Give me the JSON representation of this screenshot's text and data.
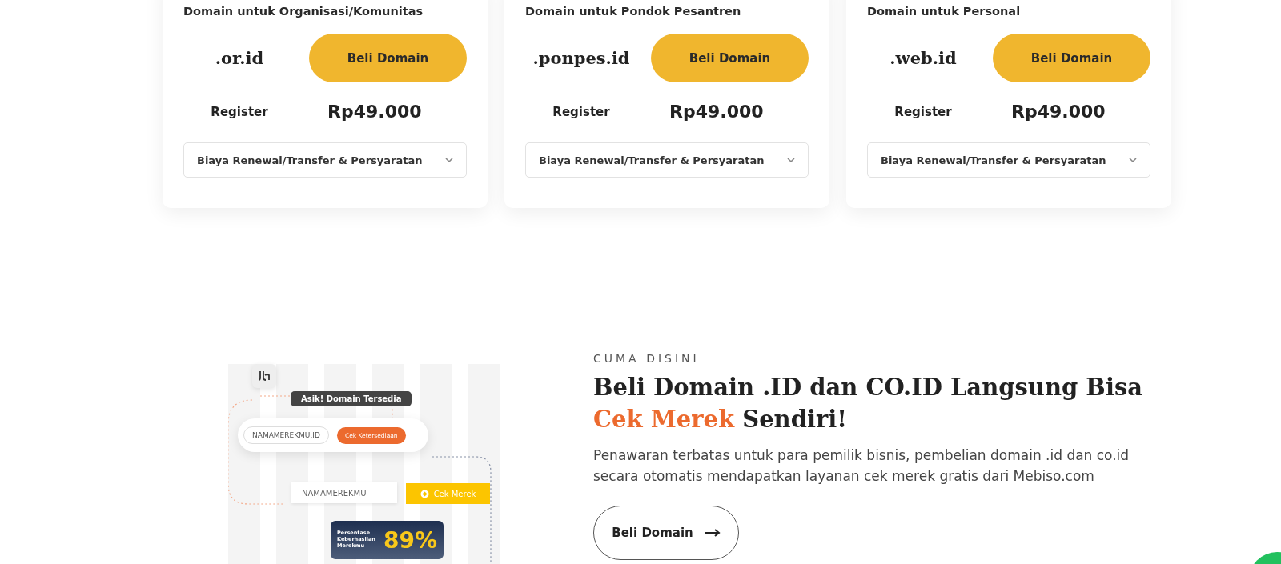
{
  "domain_cards": [
    {
      "subtitle": "Domain untuk Organisasi/Komunitas",
      "extension": ".or.id",
      "buy_button": "Beli Domain",
      "price_label": "Register",
      "price": "Rp49.000",
      "details_dropdown": {
        "label": "Biaya Renewal/Transfer & Persyaratan",
        "expanded": false
      }
    },
    {
      "subtitle": "Domain untuk Pondok Pesantren",
      "extension": ".ponpes.id",
      "buy_button": "Beli Domain",
      "price_label": "Register",
      "price": "Rp49.000",
      "details_dropdown": {
        "label": "Biaya Renewal/Transfer & Persyaratan",
        "expanded": false
      }
    },
    {
      "subtitle": "Domain untuk Personal",
      "extension": ".web.id",
      "buy_button": "Beli Domain",
      "price_label": "Register",
      "price": "Rp49.000",
      "details_dropdown": {
        "label": "Biaya Renewal/Transfer & Persyaratan",
        "expanded": false
      }
    }
  ],
  "promo": {
    "illustration": {
      "tooltip": "Asik! Domain Tersedia",
      "domain_input": "NAMAMEREKMU.ID",
      "check_button": "Cek Ketersediaan",
      "brand_input": "NAMAMEREKMU",
      "brand_button": "Cek Merek",
      "success_label": "Persentase Keberhasilan Merekmu",
      "success_value": "89%"
    },
    "eyebrow": "CUMA DISINI",
    "headline": "Beli Domain .ID dan CO.ID Langsung Bisa",
    "headline_highlight": "Cek Merek",
    "headline_rest": "Sendiri!",
    "description": "Penawaran terbatas untuk para pemilik bisnis, pembelian domain .id dan co.id secara otomatis mendapatkan layanan cek merek gratis dari Mebiso.com",
    "cta_button": "Beli Domain"
  }
}
